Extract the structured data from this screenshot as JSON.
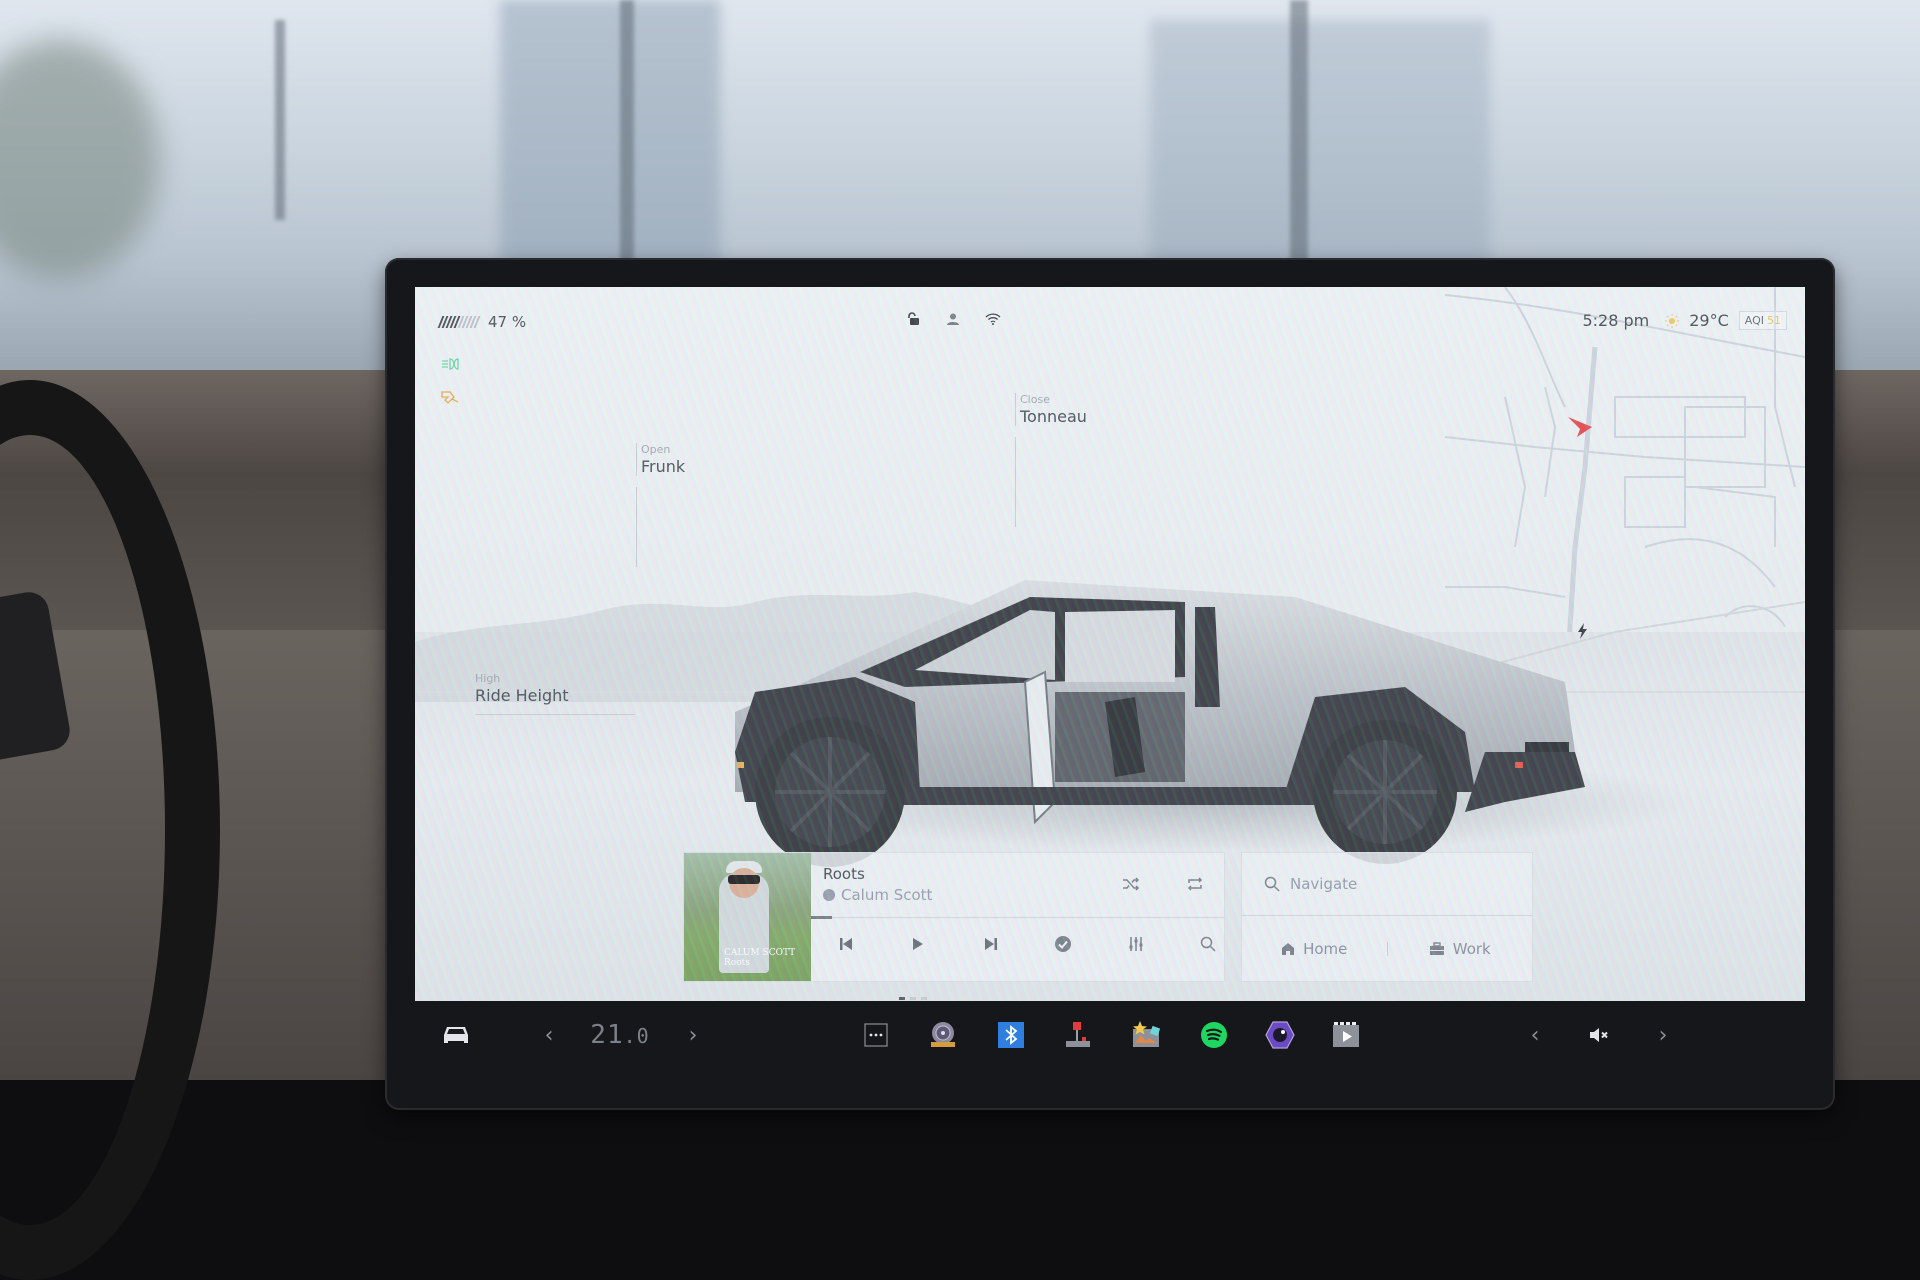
{
  "status_bar": {
    "battery_percent_label": "47 %",
    "battery_level": 0.47,
    "battery_segments_filled": 5,
    "battery_segments_total": 10,
    "lock_state": "unlocked",
    "clock": "5:28 pm",
    "weather_icon": "sun-icon",
    "temperature": "29°C",
    "aqi_label": "AQI",
    "aqi_value": "51",
    "icons": [
      "unlock-icon",
      "profile-icon",
      "wifi-icon"
    ],
    "side_indicators": [
      "headlights-icon",
      "seat-belt-warning-icon"
    ]
  },
  "vehicle_controls": {
    "frunk": {
      "state": "Open",
      "name": "Frunk"
    },
    "tonneau": {
      "state": "Close",
      "name": "Tonneau"
    },
    "ride_height": {
      "state": "High",
      "name": "Ride Height"
    },
    "charge_port_icon": "lightning-icon"
  },
  "map": {
    "position_marker": "navigation-arrow-icon",
    "marker_color": "#e63a3f"
  },
  "media": {
    "track_title": "Roots",
    "artist": "Calum Scott",
    "source_icon": "spotify-icon",
    "album_art_text_line1": "CALUM SCOTT",
    "album_art_text_line2": "Roots",
    "progress": 0.05,
    "controls": [
      "shuffle",
      "repeat",
      "previous",
      "play",
      "next",
      "liked",
      "equalizer",
      "search"
    ],
    "page_indicator": {
      "count": 3,
      "active": 0
    }
  },
  "navigation": {
    "placeholder": "Navigate",
    "shortcuts": [
      {
        "label": "Home",
        "icon": "home-icon"
      },
      {
        "label": "Work",
        "icon": "briefcase-icon"
      }
    ]
  },
  "bottom_bar": {
    "car_icon": "car-icon",
    "cabin_temp": "21",
    "cabin_temp_decimal": ".0",
    "apps": [
      {
        "name": "more-apps",
        "icon": "ellipsis-icon"
      },
      {
        "name": "dashcam",
        "icon": "dashcam-icon"
      },
      {
        "name": "bluetooth",
        "icon": "bluetooth-icon",
        "color": "#2f7fe0"
      },
      {
        "name": "arcade",
        "icon": "joystick-icon"
      },
      {
        "name": "toybox",
        "icon": "toybox-icon"
      },
      {
        "name": "spotify",
        "icon": "spotify-icon",
        "color": "#1ed760"
      },
      {
        "name": "camera",
        "icon": "camera-lens-icon",
        "color": "#6b4ac4"
      },
      {
        "name": "theater",
        "icon": "theater-icon"
      }
    ],
    "volume_state": "muted"
  },
  "colors": {
    "accent_red": "#e63a3f",
    "aqi_yellow": "#e5bf4f",
    "text_dark": "#3b3f45",
    "text_muted": "#8e95a5"
  }
}
